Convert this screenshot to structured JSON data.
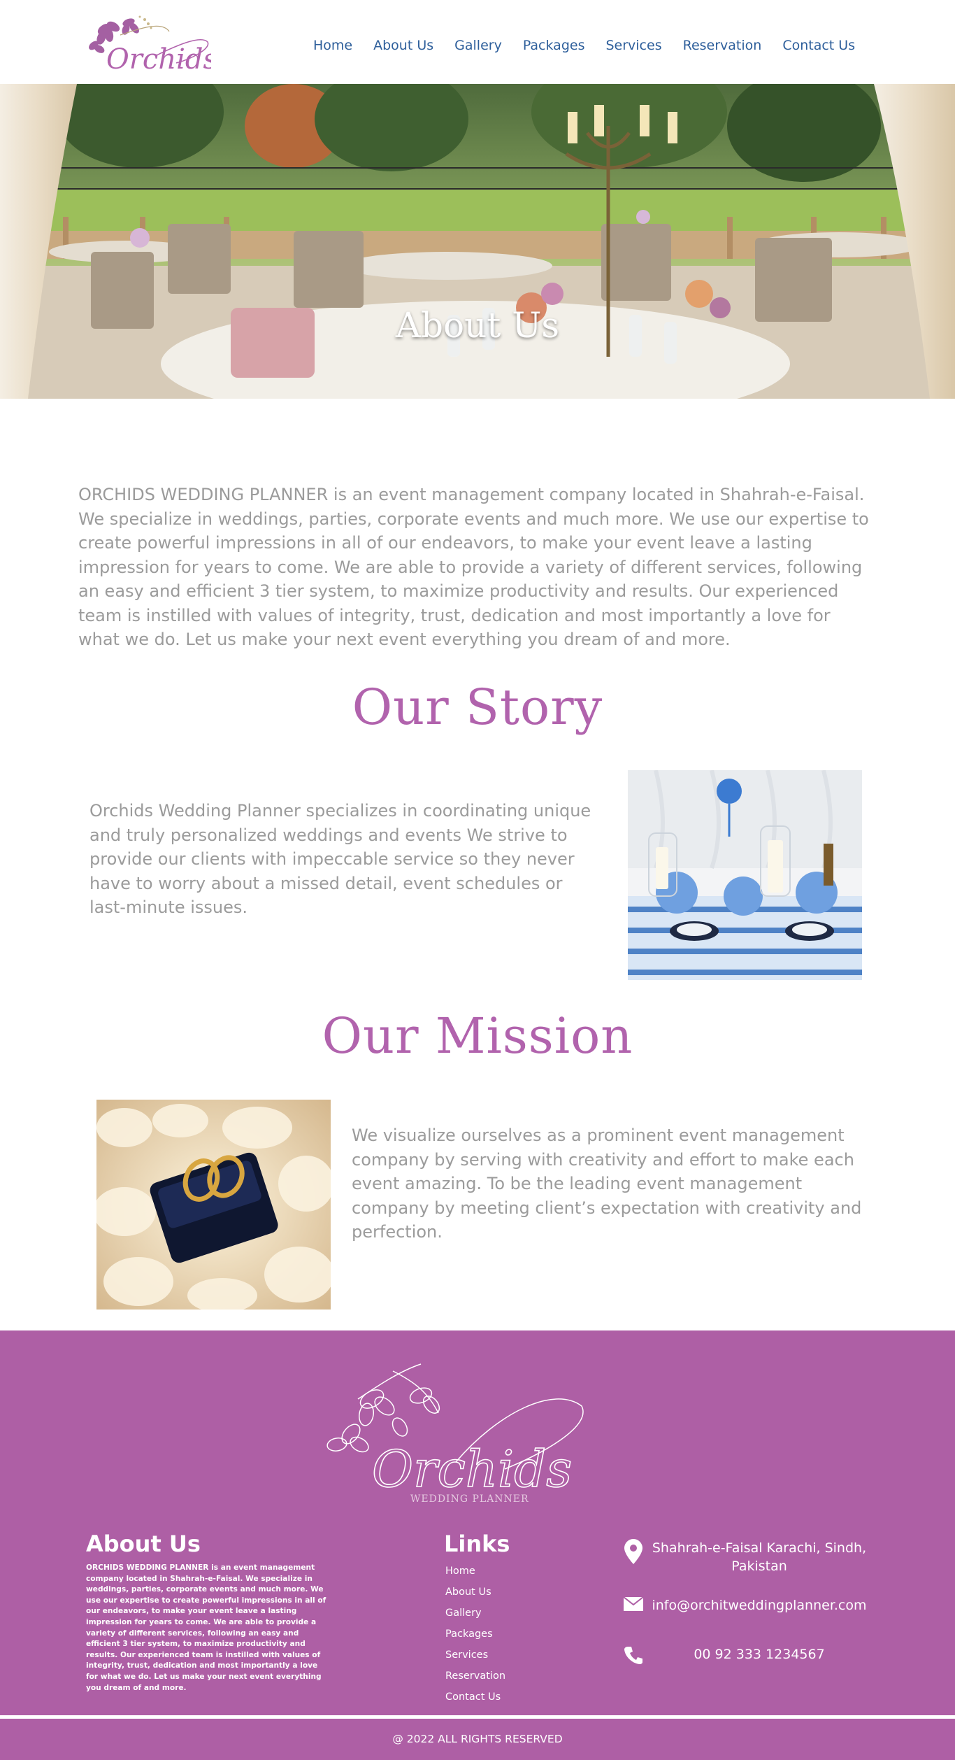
{
  "brand": {
    "logo_text": "Orchids",
    "footer_logo_text": "Orchids",
    "footer_logo_subtitle": "WEDDING PLANNER"
  },
  "nav": {
    "items": [
      {
        "label": "Home"
      },
      {
        "label": "About Us"
      },
      {
        "label": "Gallery"
      },
      {
        "label": "Packages"
      },
      {
        "label": "Services"
      },
      {
        "label": "Reservation"
      },
      {
        "label": "Contact Us"
      }
    ]
  },
  "hero": {
    "title": "About Us"
  },
  "intro": {
    "text": "ORCHIDS WEDDING PLANNER is an event management company located in Shahrah-e-Faisal. We specialize in weddings, parties, corporate events and much more. We use our expertise to create powerful impressions in all of our endeavors, to make your event leave a lasting impression for years to come. We are able to provide a variety of different services, following an easy and efficient 3 tier system, to maximize productivity and results. Our experienced team is instilled with values of integrity, trust, dedication and most importantly a love for what we do. Let us make your next event everything you dream of and more."
  },
  "story": {
    "title": "Our Story",
    "text": "Orchids Wedding Planner specializes in coordinating unique and truly personalized weddings and events We strive to provide our clients with impeccable service so they never have to worry about a missed detail, event schedules or last-minute issues."
  },
  "mission": {
    "title": "Our Mission",
    "text": "We visualize ourselves as a prominent event management company by serving with creativity and effort to make each event amazing. To be the leading event management company by meeting client’s expectation with creativity and perfection."
  },
  "footer": {
    "about_heading": "About Us",
    "about_text": "ORCHIDS WEDDING PLANNER is an event management company located in Shahrah-e-Faisal. We specialize in weddings, parties, corporate events and much more. We use our expertise to create powerful impressions in all of our endeavors, to make your event leave a lasting impression for years to come. We are able to provide a variety of different services, following an easy and efficient 3 tier system, to maximize productivity and results. Our experienced team is instilled with values of integrity, trust, dedication and most importantly a love for what we do. Let us make your next event everything you dream of and more.",
    "links_heading": "Links",
    "links": [
      {
        "label": "Home"
      },
      {
        "label": "About Us"
      },
      {
        "label": "Gallery"
      },
      {
        "label": "Packages"
      },
      {
        "label": "Services"
      },
      {
        "label": "Reservation"
      },
      {
        "label": "Contact Us"
      }
    ],
    "contact": {
      "address": "Shahrah-e-Faisal Karachi, Sindh, Pakistan",
      "email": "info@orchitweddingplanner.com",
      "phone": "00 92 333 1234567",
      "address_icon": "map-pin-icon",
      "email_icon": "envelope-icon",
      "phone_icon": "phone-icon"
    },
    "copyright": "@ 2022 ALL RIGHTS RESERVED"
  },
  "colors": {
    "brand_purple": "#ae5fa5",
    "nav_blue": "#2e5f9b",
    "body_grey": "#9b9b9b"
  }
}
